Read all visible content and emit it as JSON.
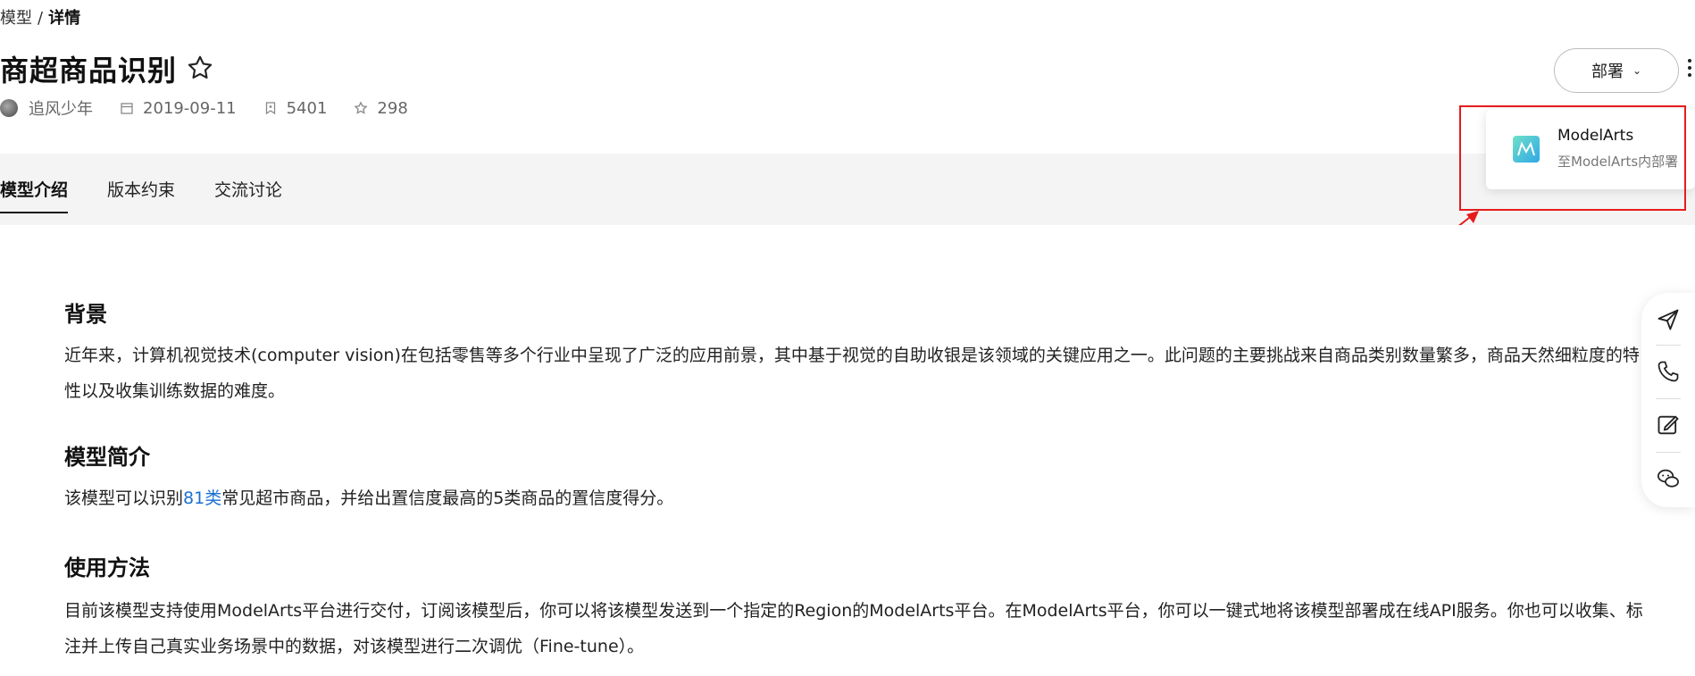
{
  "breadcrumb": {
    "parent": "模型",
    "separator": "/",
    "current": "详情"
  },
  "model": {
    "title": "商超商品识别",
    "author": "追风少年",
    "date": "2019-09-11",
    "subscriptions": "5401",
    "favorites": "298"
  },
  "actions": {
    "deploy_label": "部署"
  },
  "tabs": [
    {
      "label": "模型介绍"
    },
    {
      "label": "版本约束"
    },
    {
      "label": "交流讨论"
    }
  ],
  "deploy_menu": {
    "items": [
      {
        "name": "ModelArts",
        "desc": "至ModelArts内部署"
      }
    ]
  },
  "sections": {
    "background": {
      "heading": "背景",
      "text": "近年来，计算机视觉技术(computer vision)在包括零售等多个行业中呈现了广泛的应用前景，其中基于视觉的自助收银是该领域的关键应用之一。此问题的主要挑战来自商品类别数量繁多，商品天然细粒度的特性以及收集训练数据的难度。"
    },
    "intro": {
      "heading": "模型简介",
      "text_before": "该模型可以识别",
      "link": "81类",
      "text_after": "常见超市商品，并给出置信度最高的5类商品的置信度得分。"
    },
    "usage": {
      "heading": "使用方法",
      "text": "目前该模型支持使用ModelArts平台进行交付，订阅该模型后，你可以将该模型发送到一个指定的Region的ModelArts平台。在ModelArts平台，你可以一键式地将该模型部署成在线API服务。你也可以收集、标注并上传自己真实业务场景中的数据，对该模型进行二次调优（Fine-tune）。"
    }
  },
  "colors": {
    "link": "#1a6fd1",
    "highlight": "#e51c1c",
    "tab_bg": "#f4f4f4"
  },
  "float_icons": [
    "send-icon",
    "phone-icon",
    "edit-icon",
    "wechat-icon"
  ]
}
